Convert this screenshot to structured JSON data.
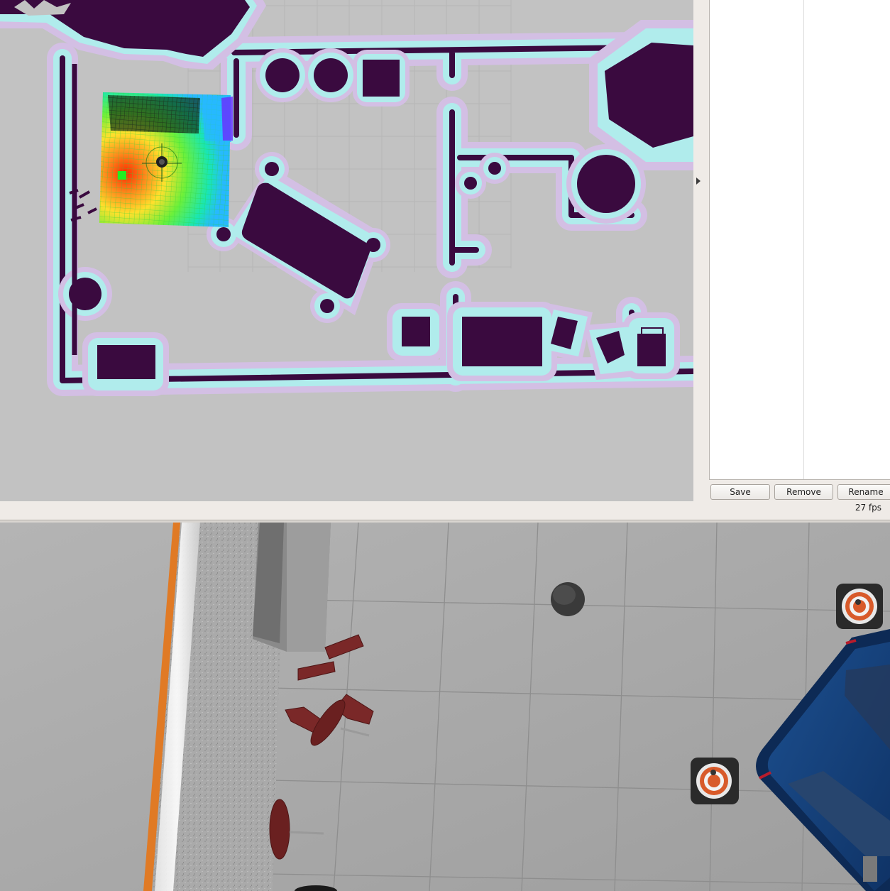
{
  "panel": {
    "buttons": {
      "save": "Save",
      "remove": "Remove",
      "rename": "Rename"
    },
    "fps": "27 fps"
  },
  "colors": {
    "map_background": "#c2c2c2",
    "obstacle": "#3a0a3f",
    "inflation_inner": "#b0ecec",
    "inflation_outer": "#d3bfe4",
    "goal_marker": "#22ee22",
    "floor": "#a9a9a9"
  },
  "icons": {
    "splitter": "triangle-right-icon"
  }
}
